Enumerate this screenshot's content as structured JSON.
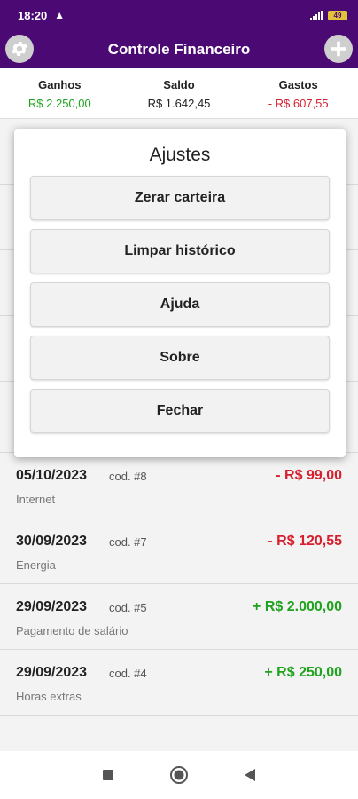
{
  "status": {
    "time": "18:20",
    "warning_icon": "warning-icon",
    "battery": "49"
  },
  "app": {
    "title": "Controle Financeiro",
    "settings_icon": "gear-icon",
    "add_icon": "plus-circle-icon"
  },
  "summary": {
    "income": {
      "label": "Ganhos",
      "value": "R$ 2.250,00"
    },
    "balance": {
      "label": "Saldo",
      "value": "R$ 1.642,45"
    },
    "expenses": {
      "label": "Gastos",
      "value": "- R$ 607,55"
    }
  },
  "colors": {
    "purple": "#4b0a73",
    "green": "#1fa31f",
    "red": "#d6202e"
  },
  "transactions": [
    {
      "date": "05/10/2023",
      "code": "cod. #8",
      "description": "Internet",
      "amount": "- R$ 99,00",
      "type": "expense"
    },
    {
      "date": "30/09/2023",
      "code": "cod. #7",
      "description": "Energia",
      "amount": "- R$ 120,55",
      "type": "expense"
    },
    {
      "date": "29/09/2023",
      "code": "cod. #5",
      "description": "Pagamento de salário",
      "amount": "+ R$ 2.000,00",
      "type": "income"
    },
    {
      "date": "29/09/2023",
      "code": "cod. #4",
      "description": "Horas extras",
      "amount": "+ R$ 250,00",
      "type": "income"
    }
  ],
  "dialog": {
    "title": "Ajustes",
    "buttons": [
      "Zerar carteira",
      "Limpar histórico",
      "Ajuda",
      "Sobre",
      "Fechar"
    ]
  }
}
